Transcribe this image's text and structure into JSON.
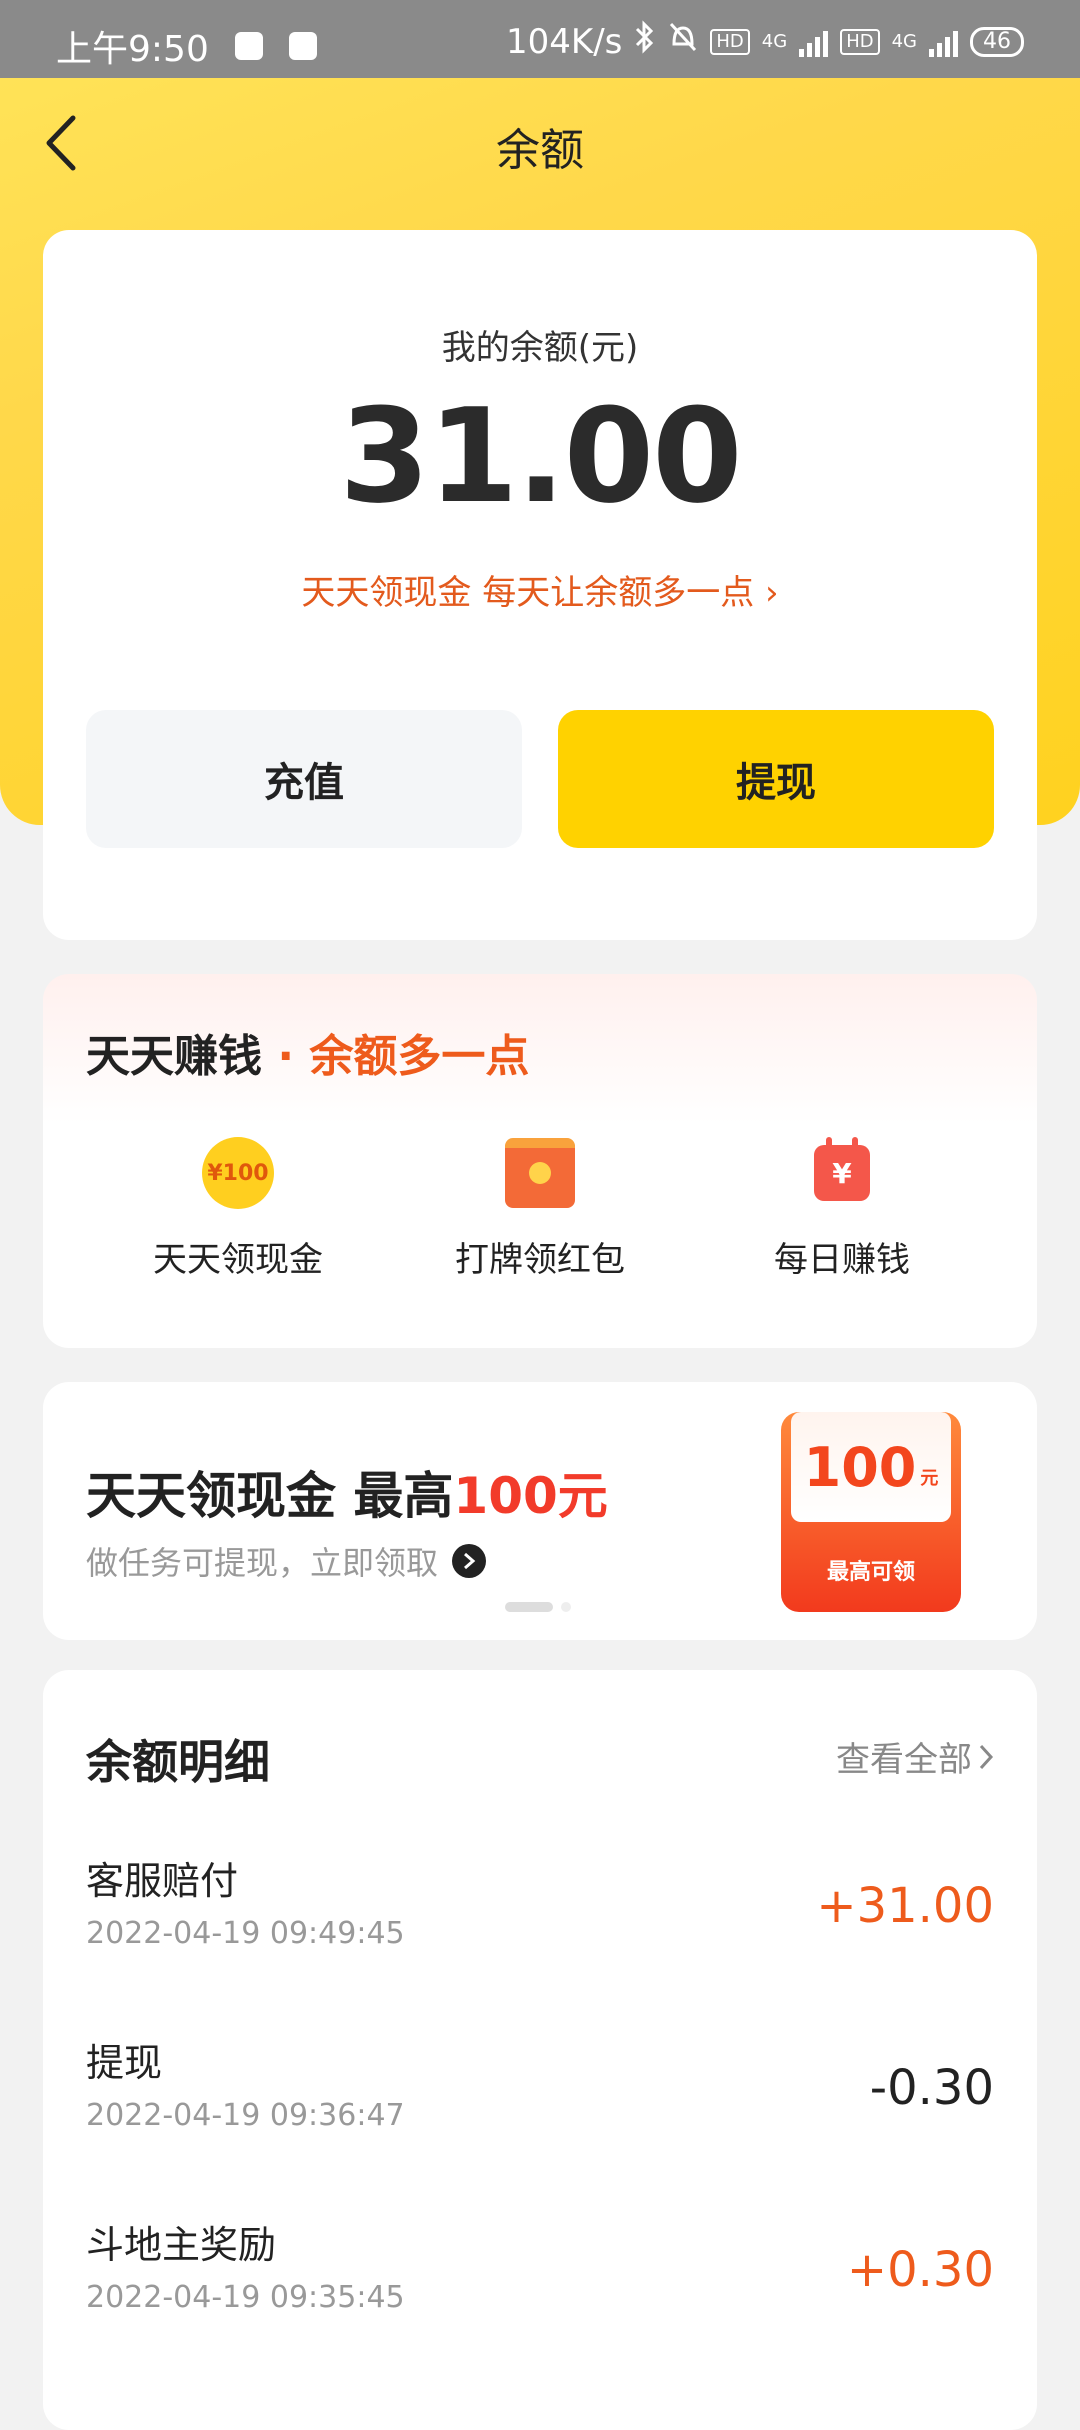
{
  "status_bar": {
    "time": "上午9:50",
    "speed": "104K/s",
    "net1": "4G",
    "net2": "4G",
    "hd": "HD",
    "battery": "46"
  },
  "nav": {
    "title": "余额",
    "back_icon": "chevron-left-icon"
  },
  "balance": {
    "label": "我的余额(元)",
    "amount": "31.00",
    "promo": "天天领现金 每天让余额多一点 ›",
    "recharge_label": "充值",
    "withdraw_label": "提现"
  },
  "earn": {
    "title": "天天赚钱",
    "subtitle": "· 余额多一点",
    "items": [
      {
        "label": "天天领现金",
        "icon": "coin-icon",
        "icon_text": "¥100"
      },
      {
        "label": "打牌领红包",
        "icon": "red-packet-icon"
      },
      {
        "label": "每日赚钱",
        "icon": "calendar-icon",
        "icon_text": "¥"
      }
    ]
  },
  "banner": {
    "title_main": "天天领现金 最高",
    "title_red": "100元",
    "subtitle": "做任务可提现，立即领取",
    "envelope_amount": "100",
    "envelope_unit": "元",
    "envelope_caption": "最高可领"
  },
  "details": {
    "title": "余额明细",
    "view_all": "查看全部",
    "rows": [
      {
        "name": "客服赔付",
        "time": "2022-04-19 09:49:45",
        "amount": "+31.00",
        "positive": true
      },
      {
        "name": "提现",
        "time": "2022-04-19 09:36:47",
        "amount": "-0.30",
        "positive": false
      },
      {
        "name": "斗地主奖励",
        "time": "2022-04-19 09:35:45",
        "amount": "+0.30",
        "positive": true
      }
    ]
  },
  "colors": {
    "brand_yellow": "#ffd200",
    "accent_orange": "#ee5b1c",
    "accent_red": "#f23b2a"
  }
}
